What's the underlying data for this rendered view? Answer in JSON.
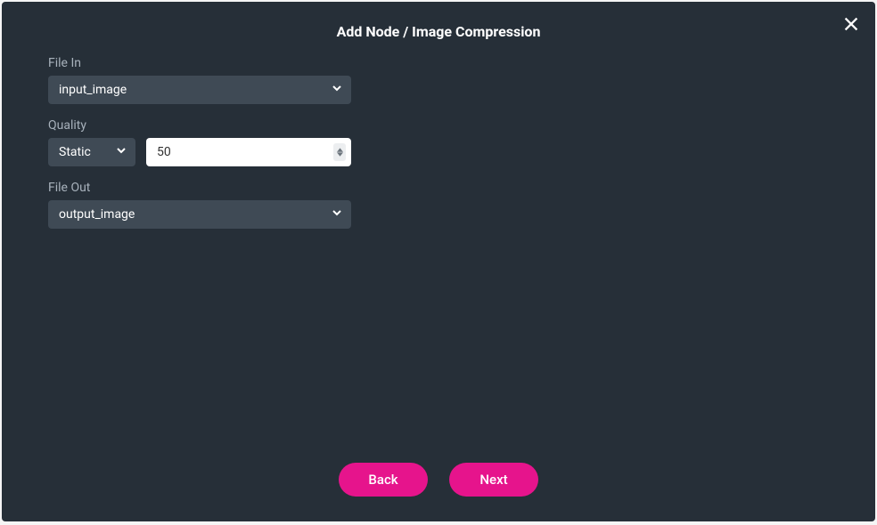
{
  "header": {
    "title": "Add Node / Image Compression"
  },
  "form": {
    "file_in": {
      "label": "File In",
      "value": "input_image"
    },
    "quality": {
      "label": "Quality",
      "mode": "Static",
      "value": "50"
    },
    "file_out": {
      "label": "File Out",
      "value": "output_image"
    }
  },
  "footer": {
    "back_label": "Back",
    "next_label": "Next"
  }
}
